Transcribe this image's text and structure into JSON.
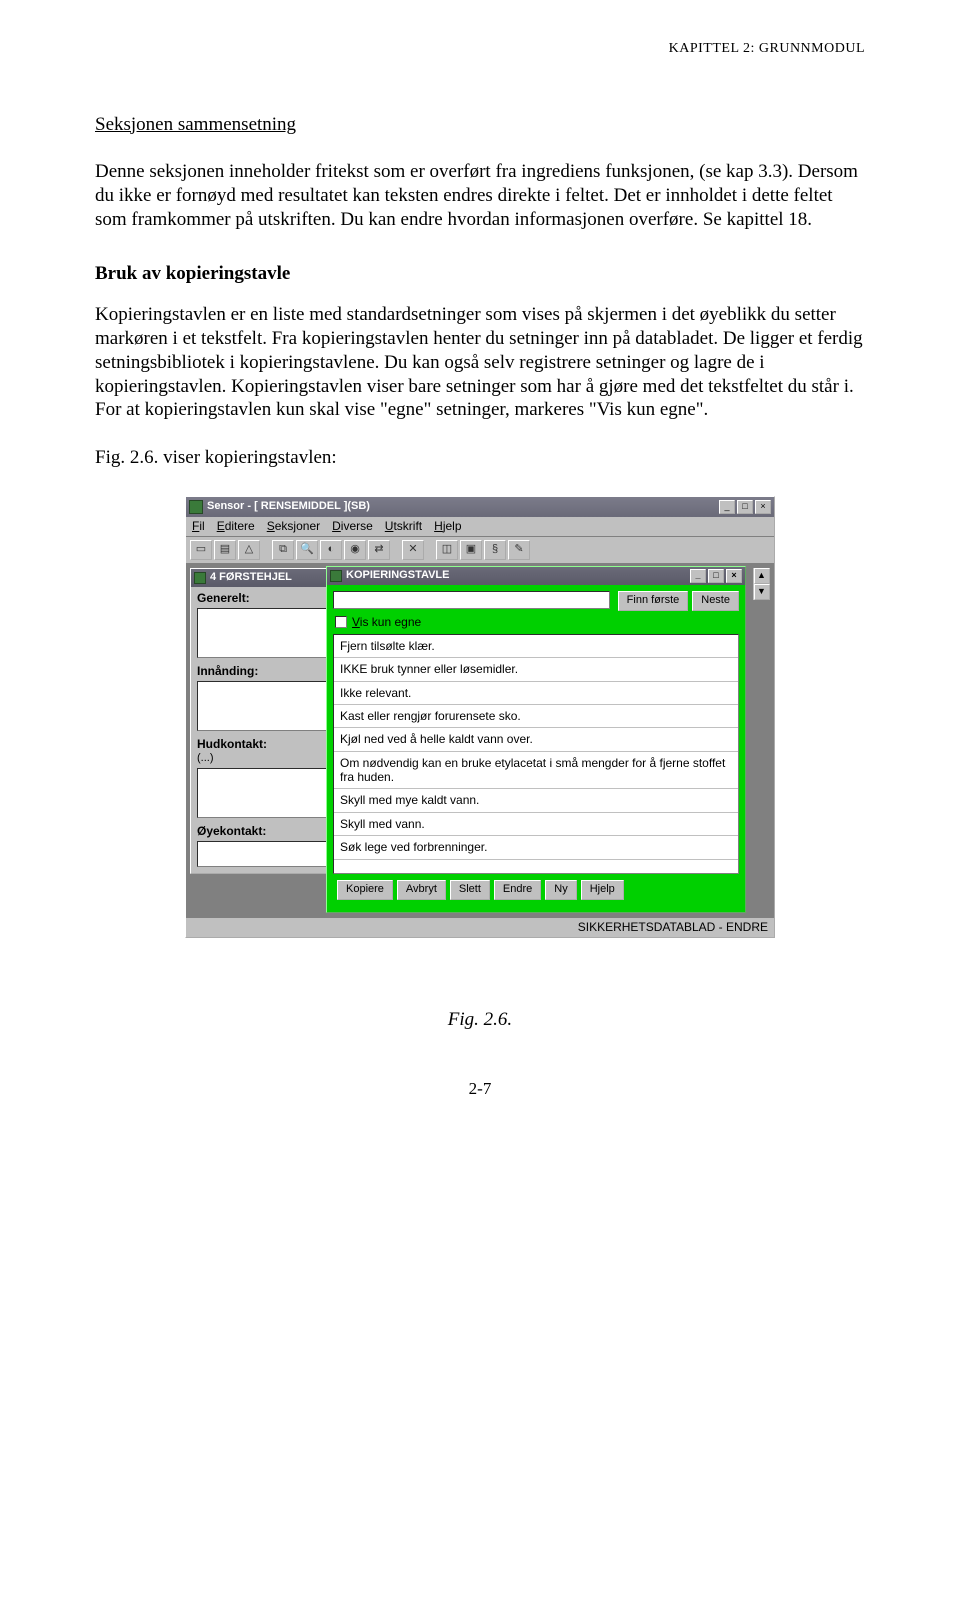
{
  "header": {
    "chapter": "KAPITTEL 2: GRUNNMODUL"
  },
  "body": {
    "section_title": "Seksjonen sammensetning",
    "p1": "Denne seksjonen inneholder fritekst som er overført fra ingrediens funksjonen, (se kap 3.3). Dersom du ikke er fornøyd med resultatet kan teksten endres direkte i feltet. Det er innholdet i dette feltet som framkommer på utskriften. Du kan endre hvordan informasjonen overføre. Se kapittel 18.",
    "subhead": "Bruk av kopieringstavle",
    "p2": "Kopieringstavlen er en liste med standardsetninger som vises på skjermen i det øyeblikk du setter markøren i et tekstfelt. Fra kopieringstavlen henter du setninger inn på databladet. De ligger et ferdig setningsbibliotek i kopieringstavlene. Du kan også selv registrere setninger og lagre de i kopieringstavlen. Kopieringstavlen viser bare setninger som har å gjøre med det tekstfeltet du står i. For at kopieringstavlen kun skal vise \"egne\" setninger, markeres \"Vis kun egne\".",
    "fig_note": "Fig. 2.6. viser kopieringstavlen:",
    "fig_caption": "Fig. 2.6."
  },
  "screenshot": {
    "app_title": "Sensor - [ RENSEMIDDEL ](SB)",
    "menu": [
      "Fil",
      "Editere",
      "Seksjoner",
      "Diverse",
      "Utskrift",
      "Hjelp"
    ],
    "toolbar_icons": [
      "doc",
      "stack",
      "warn",
      "copy",
      "find",
      "globe",
      "eye",
      "swap",
      "cross",
      "truck",
      "car",
      "section",
      "note"
    ],
    "left_window": {
      "title": "4 FØRSTEHJEL",
      "labels": {
        "generelt": "Generelt:",
        "innanding": "Innånding:",
        "hudkontakt": "Hudkontakt:",
        "hud_sub": "(...)",
        "oyekontakt": "Øyekontakt:"
      }
    },
    "popup": {
      "title": "KOPIERINGSTAVLE",
      "btn_finn": "Finn første",
      "btn_neste": "Neste",
      "checkbox_label_mnem": "V",
      "checkbox_label_rest": "is kun egne",
      "items": [
        "Fjern tilsølte klær.",
        "IKKE bruk tynner eller løsemidler.",
        "Ikke relevant.",
        "Kast eller rengjør forurensete sko.",
        "Kjøl ned ved å helle kaldt vann over.",
        "Om nødvendig kan en bruke etylacetat i små mengder for å fjerne stoffet fra huden.",
        "Skyll med mye kaldt vann.",
        "Skyll med vann.",
        "Søk lege ved forbrenninger."
      ],
      "buttons": [
        "Kopiere",
        "Avbryt",
        "Slett",
        "Endre",
        "Ny",
        "Hjelp"
      ]
    },
    "status": "SIKKERHETSDATABLAD - ENDRE"
  },
  "page_number": "2-7"
}
